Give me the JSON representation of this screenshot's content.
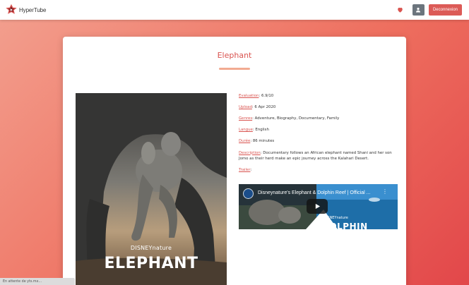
{
  "navbar": {
    "brand": "HyperTube",
    "logout_label": "Deconnexion",
    "icons": {
      "favorites": "heart-icon",
      "profile": "user-icon",
      "logo": "logo-icon"
    }
  },
  "movie": {
    "title": "Elephant",
    "poster": {
      "brand_text": "DISNEYnature",
      "title_text": "ELEPHANT"
    },
    "details": [
      {
        "label": "Evaluation",
        "value": "6.9/10"
      },
      {
        "label": "Upload",
        "value": "6 Apr 2020"
      },
      {
        "label": "Genres",
        "value": "Adventure, Biography, Documentary, Family"
      },
      {
        "label": "Langue",
        "value": "English"
      },
      {
        "label": "Durée",
        "value": "86 minutes"
      },
      {
        "label": "Description",
        "value": "Documentary follows an African elephant named Shani and her son Jomo as their herd make an epic journey across the Kalahari Desert."
      },
      {
        "label": "Trailer",
        "value": ""
      }
    ],
    "trailer": {
      "title": "Disneynature's Elephant & Dolphin Reef | Official ...",
      "overlay_brand": "DISNEYnature",
      "overlay_text": "DOLPHIN"
    }
  },
  "status": {
    "text": "En attente de yts.mx..."
  },
  "colors": {
    "accent": "#d9534f",
    "underline": "#f2ab91",
    "logout": "#dc5b57",
    "profile_button": "#6c757d",
    "background_start": "#f3a08f",
    "background_end": "#e2474a"
  }
}
